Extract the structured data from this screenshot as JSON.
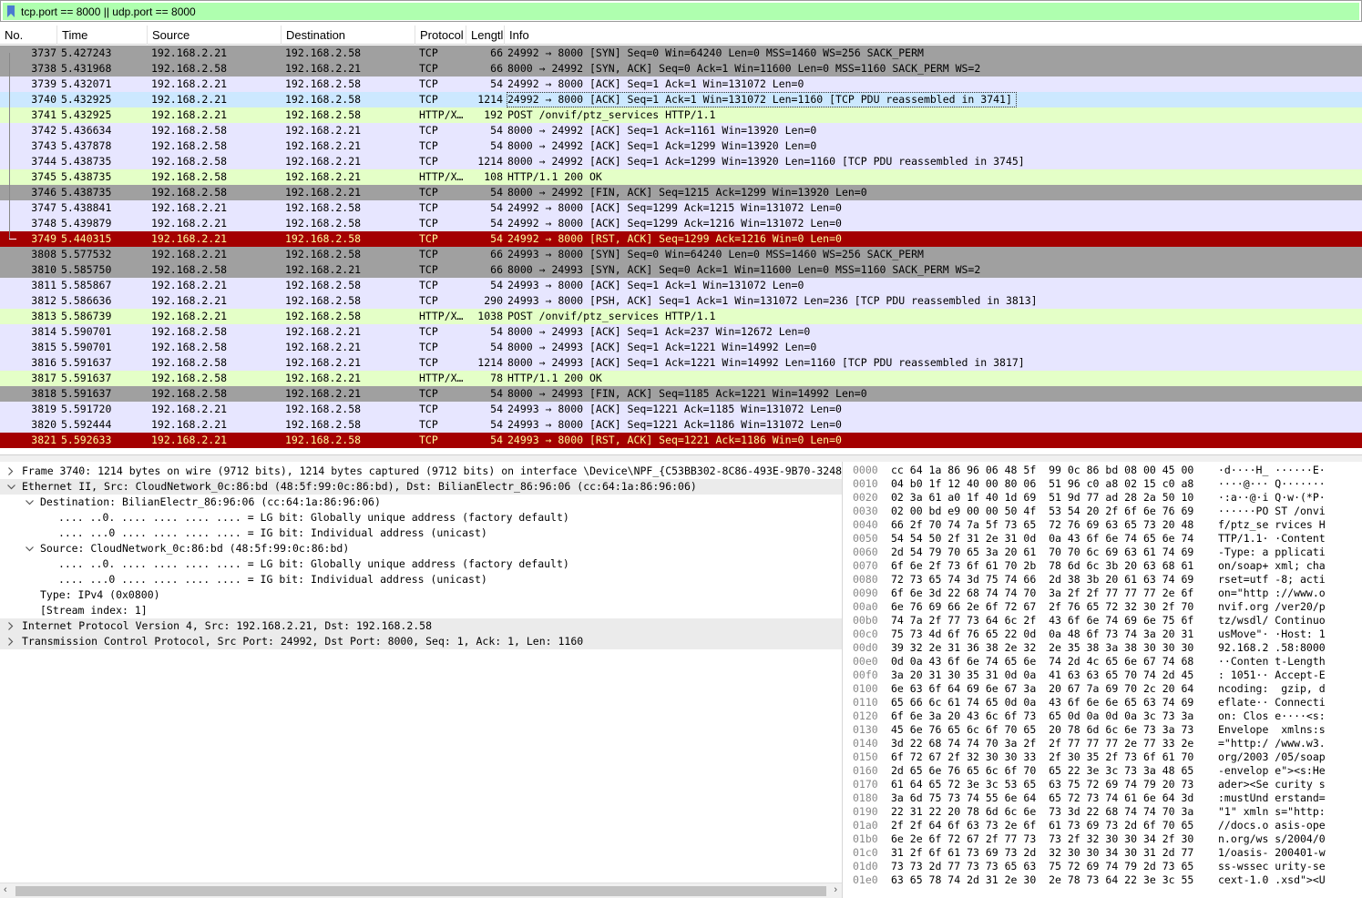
{
  "filter": {
    "text": "tcp.port == 8000 || udp.port == 8000"
  },
  "columns": [
    "No.",
    "Time",
    "Source",
    "Destination",
    "Protocol",
    "Lengtl",
    "Info"
  ],
  "packets": [
    {
      "no": "3737",
      "time": "5.427243",
      "src": "192.168.2.21",
      "dst": "192.168.2.58",
      "proto": "TCP",
      "len": "66",
      "info": "24992 → 8000 [SYN] Seq=0 Win=64240 Len=0 MSS=1460 WS=256 SACK_PERM",
      "style": "syn"
    },
    {
      "no": "3738",
      "time": "5.431968",
      "src": "192.168.2.58",
      "dst": "192.168.2.21",
      "proto": "TCP",
      "len": "66",
      "info": "8000 → 24992 [SYN, ACK] Seq=0 Ack=1 Win=11600 Len=0 MSS=1160 SACK_PERM WS=2",
      "style": "syn"
    },
    {
      "no": "3739",
      "time": "5.432071",
      "src": "192.168.2.21",
      "dst": "192.168.2.58",
      "proto": "TCP",
      "len": "54",
      "info": "24992 → 8000 [ACK] Seq=1 Ack=1 Win=131072 Len=0",
      "style": "tcp"
    },
    {
      "no": "3740",
      "time": "5.432925",
      "src": "192.168.2.21",
      "dst": "192.168.2.58",
      "proto": "TCP",
      "len": "1214",
      "info": "24992 → 8000 [ACK] Seq=1 Ack=1 Win=131072 Len=1160 [TCP PDU reassembled in 3741]",
      "style": "sel"
    },
    {
      "no": "3741",
      "time": "5.432925",
      "src": "192.168.2.21",
      "dst": "192.168.2.58",
      "proto": "HTTP/X…",
      "len": "192",
      "info": "POST /onvif/ptz_services HTTP/1.1",
      "style": "http"
    },
    {
      "no": "3742",
      "time": "5.436634",
      "src": "192.168.2.58",
      "dst": "192.168.2.21",
      "proto": "TCP",
      "len": "54",
      "info": "8000 → 24992 [ACK] Seq=1 Ack=1161 Win=13920 Len=0",
      "style": "tcp"
    },
    {
      "no": "3743",
      "time": "5.437878",
      "src": "192.168.2.58",
      "dst": "192.168.2.21",
      "proto": "TCP",
      "len": "54",
      "info": "8000 → 24992 [ACK] Seq=1 Ack=1299 Win=13920 Len=0",
      "style": "tcp"
    },
    {
      "no": "3744",
      "time": "5.438735",
      "src": "192.168.2.58",
      "dst": "192.168.2.21",
      "proto": "TCP",
      "len": "1214",
      "info": "8000 → 24992 [ACK] Seq=1 Ack=1299 Win=13920 Len=1160 [TCP PDU reassembled in 3745]",
      "style": "tcp"
    },
    {
      "no": "3745",
      "time": "5.438735",
      "src": "192.168.2.58",
      "dst": "192.168.2.21",
      "proto": "HTTP/X…",
      "len": "108",
      "info": "HTTP/1.1 200 OK",
      "style": "http"
    },
    {
      "no": "3746",
      "time": "5.438735",
      "src": "192.168.2.58",
      "dst": "192.168.2.21",
      "proto": "TCP",
      "len": "54",
      "info": "8000 → 24992 [FIN, ACK] Seq=1215 Ack=1299 Win=13920 Len=0",
      "style": "syn"
    },
    {
      "no": "3747",
      "time": "5.438841",
      "src": "192.168.2.21",
      "dst": "192.168.2.58",
      "proto": "TCP",
      "len": "54",
      "info": "24992 → 8000 [ACK] Seq=1299 Ack=1215 Win=131072 Len=0",
      "style": "tcp"
    },
    {
      "no": "3748",
      "time": "5.439879",
      "src": "192.168.2.21",
      "dst": "192.168.2.58",
      "proto": "TCP",
      "len": "54",
      "info": "24992 → 8000 [ACK] Seq=1299 Ack=1216 Win=131072 Len=0",
      "style": "tcp"
    },
    {
      "no": "3749",
      "time": "5.440315",
      "src": "192.168.2.21",
      "dst": "192.168.2.58",
      "proto": "TCP",
      "len": "54",
      "info": "24992 → 8000 [RST, ACK] Seq=1299 Ack=1216 Win=0 Len=0",
      "style": "rst"
    },
    {
      "no": "3808",
      "time": "5.577532",
      "src": "192.168.2.21",
      "dst": "192.168.2.58",
      "proto": "TCP",
      "len": "66",
      "info": "24993 → 8000 [SYN] Seq=0 Win=64240 Len=0 MSS=1460 WS=256 SACK_PERM",
      "style": "syn"
    },
    {
      "no": "3810",
      "time": "5.585750",
      "src": "192.168.2.58",
      "dst": "192.168.2.21",
      "proto": "TCP",
      "len": "66",
      "info": "8000 → 24993 [SYN, ACK] Seq=0 Ack=1 Win=11600 Len=0 MSS=1160 SACK_PERM WS=2",
      "style": "syn"
    },
    {
      "no": "3811",
      "time": "5.585867",
      "src": "192.168.2.21",
      "dst": "192.168.2.58",
      "proto": "TCP",
      "len": "54",
      "info": "24993 → 8000 [ACK] Seq=1 Ack=1 Win=131072 Len=0",
      "style": "tcp"
    },
    {
      "no": "3812",
      "time": "5.586636",
      "src": "192.168.2.21",
      "dst": "192.168.2.58",
      "proto": "TCP",
      "len": "290",
      "info": "24993 → 8000 [PSH, ACK] Seq=1 Ack=1 Win=131072 Len=236 [TCP PDU reassembled in 3813]",
      "style": "tcp"
    },
    {
      "no": "3813",
      "time": "5.586739",
      "src": "192.168.2.21",
      "dst": "192.168.2.58",
      "proto": "HTTP/X…",
      "len": "1038",
      "info": "POST /onvif/ptz_services HTTP/1.1",
      "style": "http"
    },
    {
      "no": "3814",
      "time": "5.590701",
      "src": "192.168.2.58",
      "dst": "192.168.2.21",
      "proto": "TCP",
      "len": "54",
      "info": "8000 → 24993 [ACK] Seq=1 Ack=237 Win=12672 Len=0",
      "style": "tcp"
    },
    {
      "no": "3815",
      "time": "5.590701",
      "src": "192.168.2.58",
      "dst": "192.168.2.21",
      "proto": "TCP",
      "len": "54",
      "info": "8000 → 24993 [ACK] Seq=1 Ack=1221 Win=14992 Len=0",
      "style": "tcp"
    },
    {
      "no": "3816",
      "time": "5.591637",
      "src": "192.168.2.58",
      "dst": "192.168.2.21",
      "proto": "TCP",
      "len": "1214",
      "info": "8000 → 24993 [ACK] Seq=1 Ack=1221 Win=14992 Len=1160 [TCP PDU reassembled in 3817]",
      "style": "tcp"
    },
    {
      "no": "3817",
      "time": "5.591637",
      "src": "192.168.2.58",
      "dst": "192.168.2.21",
      "proto": "HTTP/X…",
      "len": "78",
      "info": "HTTP/1.1 200 OK",
      "style": "http"
    },
    {
      "no": "3818",
      "time": "5.591637",
      "src": "192.168.2.58",
      "dst": "192.168.2.21",
      "proto": "TCP",
      "len": "54",
      "info": "8000 → 24993 [FIN, ACK] Seq=1185 Ack=1221 Win=14992 Len=0",
      "style": "syn"
    },
    {
      "no": "3819",
      "time": "5.591720",
      "src": "192.168.2.21",
      "dst": "192.168.2.58",
      "proto": "TCP",
      "len": "54",
      "info": "24993 → 8000 [ACK] Seq=1221 Ack=1185 Win=131072 Len=0",
      "style": "tcp"
    },
    {
      "no": "3820",
      "time": "5.592444",
      "src": "192.168.2.21",
      "dst": "192.168.2.58",
      "proto": "TCP",
      "len": "54",
      "info": "24993 → 8000 [ACK] Seq=1221 Ack=1186 Win=131072 Len=0",
      "style": "tcp"
    },
    {
      "no": "3821",
      "time": "5.592633",
      "src": "192.168.2.21",
      "dst": "192.168.2.58",
      "proto": "TCP",
      "len": "54",
      "info": "24993 → 8000 [RST, ACK] Seq=1221 Ack=1186 Win=0 Len=0",
      "style": "rst"
    }
  ],
  "details": [
    {
      "level": 0,
      "arrow": "right",
      "text": "Frame 3740: 1214 bytes on wire (9712 bits), 1214 bytes captured (9712 bits) on interface \\Device\\NPF_{C53BB302-8C86-493E-9B70-3248",
      "hl": false
    },
    {
      "level": 0,
      "arrow": "down",
      "text": "Ethernet II, Src: CloudNetwork_0c:86:bd (48:5f:99:0c:86:bd), Dst: BilianElectr_86:96:06 (cc:64:1a:86:96:06)",
      "hl": true
    },
    {
      "level": 1,
      "arrow": "down",
      "text": "Destination: BilianElectr_86:96:06 (cc:64:1a:86:96:06)",
      "hl": false
    },
    {
      "level": 2,
      "arrow": "",
      "text": ".... ..0. .... .... .... .... = LG bit: Globally unique address (factory default)",
      "hl": false
    },
    {
      "level": 2,
      "arrow": "",
      "text": ".... ...0 .... .... .... .... = IG bit: Individual address (unicast)",
      "hl": false
    },
    {
      "level": 1,
      "arrow": "down",
      "text": "Source: CloudNetwork_0c:86:bd (48:5f:99:0c:86:bd)",
      "hl": false
    },
    {
      "level": 2,
      "arrow": "",
      "text": ".... ..0. .... .... .... .... = LG bit: Globally unique address (factory default)",
      "hl": false
    },
    {
      "level": 2,
      "arrow": "",
      "text": ".... ...0 .... .... .... .... = IG bit: Individual address (unicast)",
      "hl": false
    },
    {
      "level": 1,
      "arrow": "",
      "text": "Type: IPv4 (0x0800)",
      "hl": false
    },
    {
      "level": 1,
      "arrow": "",
      "text": "[Stream index: 1]",
      "hl": false
    },
    {
      "level": 0,
      "arrow": "right",
      "text": "Internet Protocol Version 4, Src: 192.168.2.21, Dst: 192.168.2.58",
      "hl": true
    },
    {
      "level": 0,
      "arrow": "right",
      "text": "Transmission Control Protocol, Src Port: 24992, Dst Port: 8000, Seq: 1, Ack: 1, Len: 1160",
      "hl": true
    }
  ],
  "bytes": [
    {
      "off": "0000",
      "hex": "cc 64 1a 86 96 06 48 5f  99 0c 86 bd 08 00 45 00",
      "ascii": "·d····H_ ······E·"
    },
    {
      "off": "0010",
      "hex": "04 b0 1f 12 40 00 80 06  51 96 c0 a8 02 15 c0 a8",
      "ascii": "····@··· Q·······"
    },
    {
      "off": "0020",
      "hex": "02 3a 61 a0 1f 40 1d 69  51 9d 77 ad 28 2a 50 10",
      "ascii": "·:a··@·i Q·w·(*P·"
    },
    {
      "off": "0030",
      "hex": "02 00 bd e9 00 00 50 4f  53 54 20 2f 6f 6e 76 69",
      "ascii": "······PO ST /onvi"
    },
    {
      "off": "0040",
      "hex": "66 2f 70 74 7a 5f 73 65  72 76 69 63 65 73 20 48",
      "ascii": "f/ptz_se rvices H"
    },
    {
      "off": "0050",
      "hex": "54 54 50 2f 31 2e 31 0d  0a 43 6f 6e 74 65 6e 74",
      "ascii": "TTP/1.1· ·Content"
    },
    {
      "off": "0060",
      "hex": "2d 54 79 70 65 3a 20 61  70 70 6c 69 63 61 74 69",
      "ascii": "-Type: a pplicati"
    },
    {
      "off": "0070",
      "hex": "6f 6e 2f 73 6f 61 70 2b  78 6d 6c 3b 20 63 68 61",
      "ascii": "on/soap+ xml; cha"
    },
    {
      "off": "0080",
      "hex": "72 73 65 74 3d 75 74 66  2d 38 3b 20 61 63 74 69",
      "ascii": "rset=utf -8; acti"
    },
    {
      "off": "0090",
      "hex": "6f 6e 3d 22 68 74 74 70  3a 2f 2f 77 77 77 2e 6f",
      "ascii": "on=\"http ://www.o"
    },
    {
      "off": "00a0",
      "hex": "6e 76 69 66 2e 6f 72 67  2f 76 65 72 32 30 2f 70",
      "ascii": "nvif.org /ver20/p"
    },
    {
      "off": "00b0",
      "hex": "74 7a 2f 77 73 64 6c 2f  43 6f 6e 74 69 6e 75 6f",
      "ascii": "tz/wsdl/ Continuo"
    },
    {
      "off": "00c0",
      "hex": "75 73 4d 6f 76 65 22 0d  0a 48 6f 73 74 3a 20 31",
      "ascii": "usMove\"· ·Host: 1"
    },
    {
      "off": "00d0",
      "hex": "39 32 2e 31 36 38 2e 32  2e 35 38 3a 38 30 30 30",
      "ascii": "92.168.2 .58:8000"
    },
    {
      "off": "00e0",
      "hex": "0d 0a 43 6f 6e 74 65 6e  74 2d 4c 65 6e 67 74 68",
      "ascii": "··Conten t-Length"
    },
    {
      "off": "00f0",
      "hex": "3a 20 31 30 35 31 0d 0a  41 63 63 65 70 74 2d 45",
      "ascii": ": 1051·· Accept-E"
    },
    {
      "off": "0100",
      "hex": "6e 63 6f 64 69 6e 67 3a  20 67 7a 69 70 2c 20 64",
      "ascii": "ncoding:  gzip, d"
    },
    {
      "off": "0110",
      "hex": "65 66 6c 61 74 65 0d 0a  43 6f 6e 6e 65 63 74 69",
      "ascii": "eflate·· Connecti"
    },
    {
      "off": "0120",
      "hex": "6f 6e 3a 20 43 6c 6f 73  65 0d 0a 0d 0a 3c 73 3a",
      "ascii": "on: Clos e····<s:"
    },
    {
      "off": "0130",
      "hex": "45 6e 76 65 6c 6f 70 65  20 78 6d 6c 6e 73 3a 73",
      "ascii": "Envelope  xmlns:s"
    },
    {
      "off": "0140",
      "hex": "3d 22 68 74 74 70 3a 2f  2f 77 77 77 2e 77 33 2e",
      "ascii": "=\"http:/ /www.w3."
    },
    {
      "off": "0150",
      "hex": "6f 72 67 2f 32 30 30 33  2f 30 35 2f 73 6f 61 70",
      "ascii": "org/2003 /05/soap"
    },
    {
      "off": "0160",
      "hex": "2d 65 6e 76 65 6c 6f 70  65 22 3e 3c 73 3a 48 65",
      "ascii": "-envelop e\"><s:He"
    },
    {
      "off": "0170",
      "hex": "61 64 65 72 3e 3c 53 65  63 75 72 69 74 79 20 73",
      "ascii": "ader><Se curity s"
    },
    {
      "off": "0180",
      "hex": "3a 6d 75 73 74 55 6e 64  65 72 73 74 61 6e 64 3d",
      "ascii": ":mustUnd erstand="
    },
    {
      "off": "0190",
      "hex": "22 31 22 20 78 6d 6c 6e  73 3d 22 68 74 74 70 3a",
      "ascii": "\"1\" xmln s=\"http:"
    },
    {
      "off": "01a0",
      "hex": "2f 2f 64 6f 63 73 2e 6f  61 73 69 73 2d 6f 70 65",
      "ascii": "//docs.o asis-ope"
    },
    {
      "off": "01b0",
      "hex": "6e 2e 6f 72 67 2f 77 73  73 2f 32 30 30 34 2f 30",
      "ascii": "n.org/ws s/2004/0"
    },
    {
      "off": "01c0",
      "hex": "31 2f 6f 61 73 69 73 2d  32 30 30 34 30 31 2d 77",
      "ascii": "1/oasis- 200401-w"
    },
    {
      "off": "01d0",
      "hex": "73 73 2d 77 73 73 65 63  75 72 69 74 79 2d 73 65",
      "ascii": "ss-wssec urity-se"
    },
    {
      "off": "01e0",
      "hex": "63 65 78 74 2d 31 2e 30  2e 78 73 64 22 3e 3c 55",
      "ascii": "cext-1.0 .xsd\"><U"
    }
  ]
}
